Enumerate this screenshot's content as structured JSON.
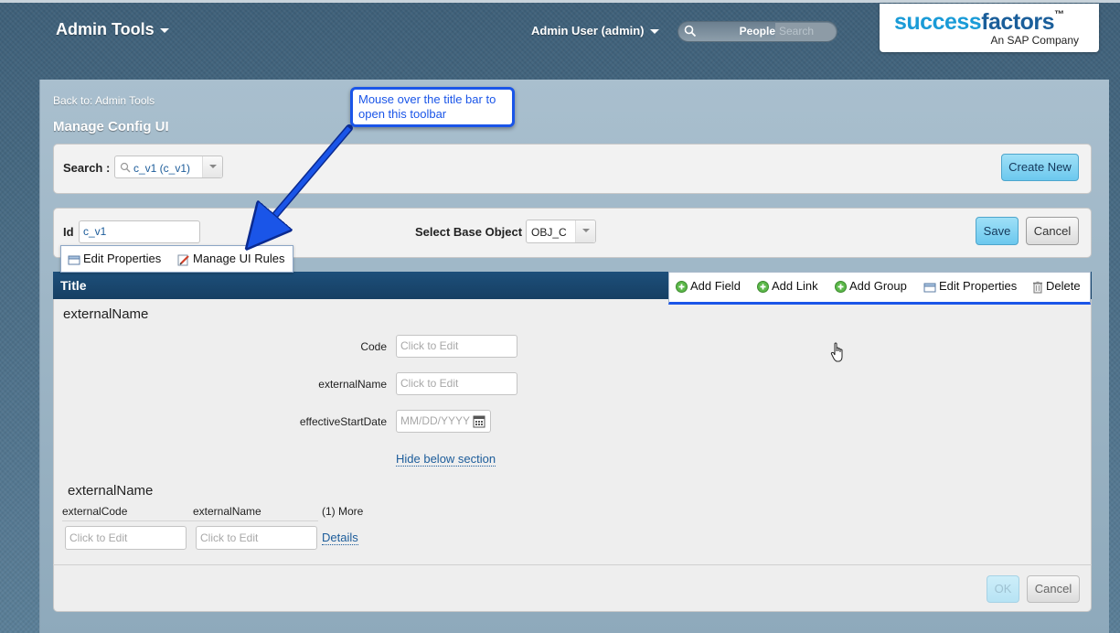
{
  "header": {
    "admin_tools_label": "Admin Tools",
    "user_menu_label": "Admin User (admin)",
    "search_scope": "People",
    "search_placeholder": "Search",
    "logo_text_light": "success",
    "logo_text_dark": "factors",
    "logo_tm": "™",
    "logo_subtitle": "An SAP Company"
  },
  "page": {
    "back_link": "Back to: Admin Tools",
    "title": "Manage Config UI"
  },
  "callout": {
    "text": "Mouse over the title bar to open this toolbar"
  },
  "search": {
    "label": "Search :",
    "value": "c_v1 (c_v1)",
    "create_new_label": "Create New"
  },
  "config": {
    "id_label": "Id",
    "id_value": "c_v1",
    "base_object_label": "Select Base Object",
    "base_object_value": "OBJ_C",
    "save_label": "Save",
    "cancel_label": "Cancel"
  },
  "mini_toolbar": {
    "edit_properties": "Edit Properties",
    "manage_ui_rules": "Manage UI Rules"
  },
  "title_bar": {
    "title": "Title"
  },
  "section_toolbar": {
    "add_field": "Add Field",
    "add_link": "Add Link",
    "add_group": "Add Group",
    "edit_properties": "Edit Properties",
    "delete": "Delete"
  },
  "form": {
    "section1_title": "externalName",
    "code_label": "Code",
    "code_placeholder": "Click to Edit",
    "external_name_label": "externalName",
    "external_name_placeholder": "Click to Edit",
    "effective_start_label": "effectiveStartDate",
    "effective_start_placeholder": "MM/DD/YYYY",
    "hide_section_link": "Hide below section",
    "section2_title": "externalName",
    "columns": [
      "externalCode",
      "externalName",
      "(1) More"
    ],
    "row_placeholders": [
      "Click to Edit",
      "Click to Edit"
    ],
    "details_link": "Details"
  },
  "footer": {
    "ok_label": "OK",
    "cancel_label": "Cancel"
  },
  "colors": {
    "accent_blue": "#1a55e8",
    "title_bar": "#1d4f7a",
    "button_blue": "#6cc8ee",
    "logo_blue": "#1a9bd7"
  }
}
